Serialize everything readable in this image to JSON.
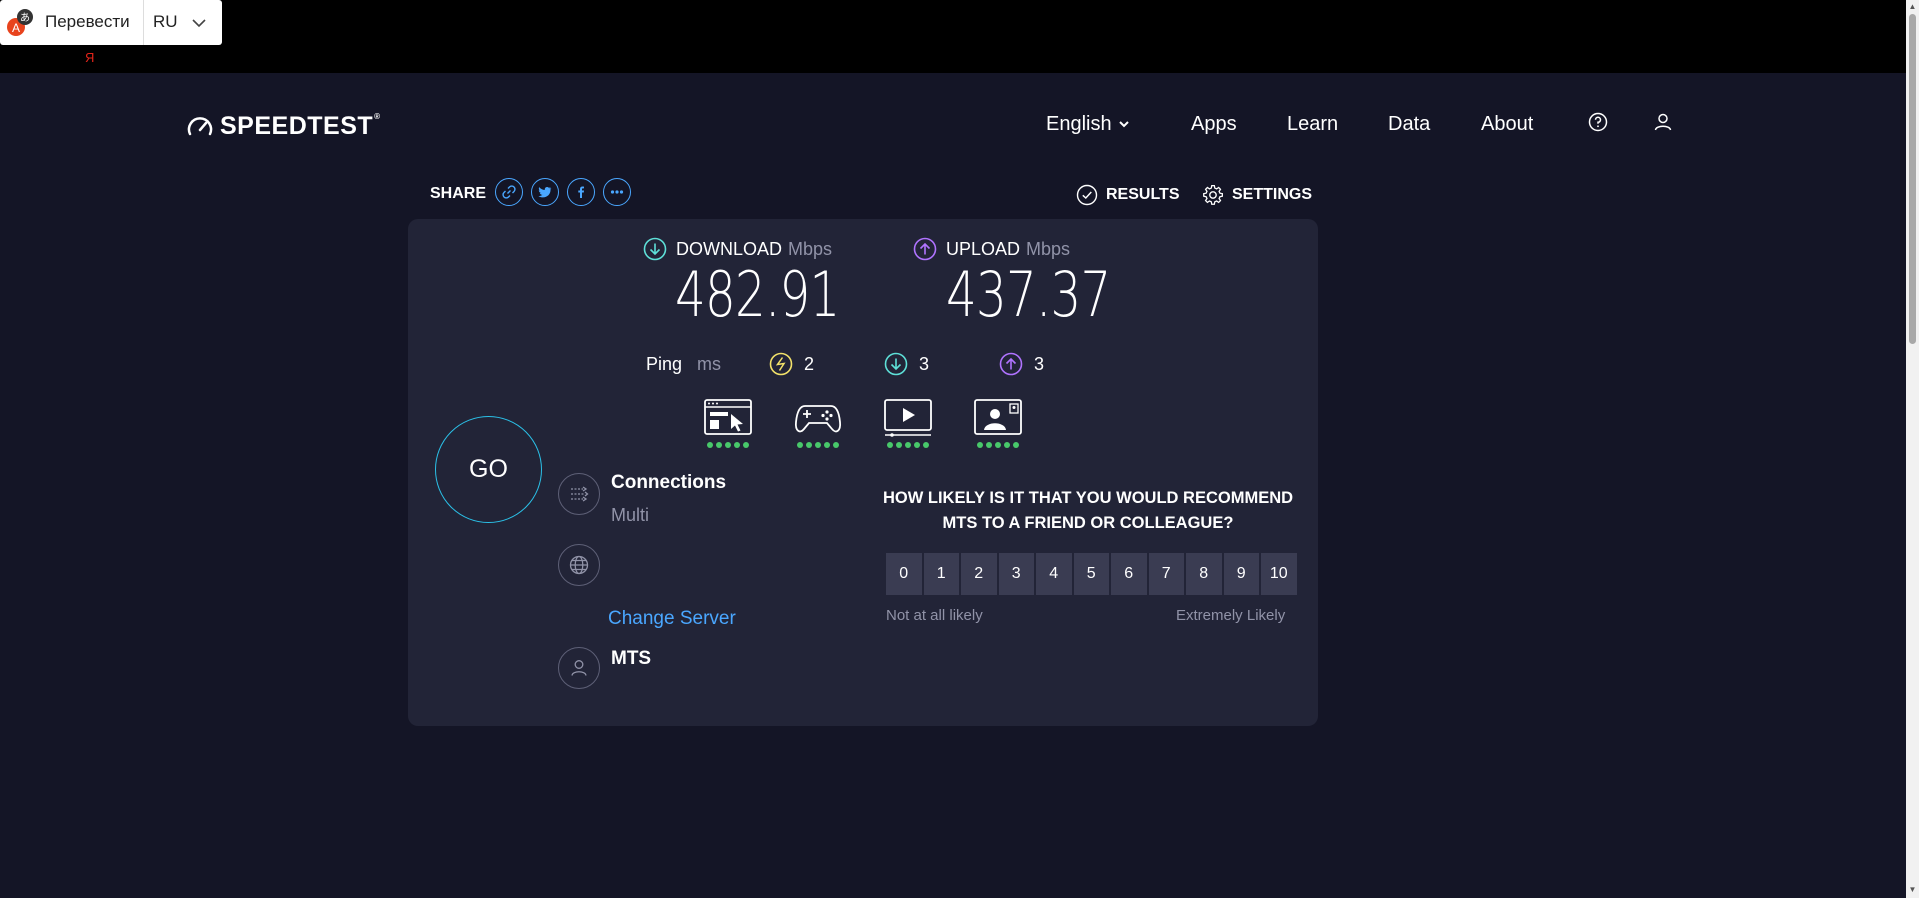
{
  "translate_bar": {
    "button_label": "Перевести",
    "language": "RU",
    "brand_mark": "Я"
  },
  "header": {
    "logo_text": "SPEEDTEST",
    "logo_tm": "®",
    "nav": {
      "english": "English",
      "apps": "Apps",
      "learn": "Learn",
      "data": "Data",
      "about": "About"
    }
  },
  "share": {
    "label": "SHARE",
    "icons": [
      "link-icon",
      "twitter-icon",
      "facebook-icon",
      "more-icon"
    ]
  },
  "toolbar": {
    "results": "RESULTS",
    "settings": "SETTINGS"
  },
  "download": {
    "label": "DOWNLOAD",
    "unit": "Mbps",
    "value": "482.91",
    "color": "#5ee0d8"
  },
  "upload": {
    "label": "UPLOAD",
    "unit": "Mbps",
    "value": "437.37",
    "color": "#b073ff"
  },
  "ping": {
    "label": "Ping",
    "unit": "ms",
    "idle": "2",
    "download": "3",
    "upload": "3",
    "idle_color": "#f3e26a"
  },
  "quality": {
    "items": [
      {
        "name": "web-browsing",
        "rating": 5
      },
      {
        "name": "gaming",
        "rating": 5
      },
      {
        "name": "video-streaming",
        "rating": 5
      },
      {
        "name": "video-chat",
        "rating": 5
      }
    ],
    "dot_color": "#48c86a"
  },
  "go_button": "GO",
  "connections": {
    "title": "Connections",
    "value": "Multi"
  },
  "server": {
    "change_label": "Change Server"
  },
  "isp": {
    "name": "MTS"
  },
  "survey": {
    "question": "HOW LIKELY IS IT THAT YOU WOULD RECOMMEND MTS TO A FRIEND OR COLLEAGUE?",
    "scale": [
      "0",
      "1",
      "2",
      "3",
      "4",
      "5",
      "6",
      "7",
      "8",
      "9",
      "10"
    ],
    "low_label": "Not at all likely",
    "high_label": "Extremely Likely"
  },
  "colors": {
    "background": "#141526",
    "card": "#222437",
    "accent_blue": "#4aa7ff",
    "go_ring": "#2bc1e8"
  }
}
